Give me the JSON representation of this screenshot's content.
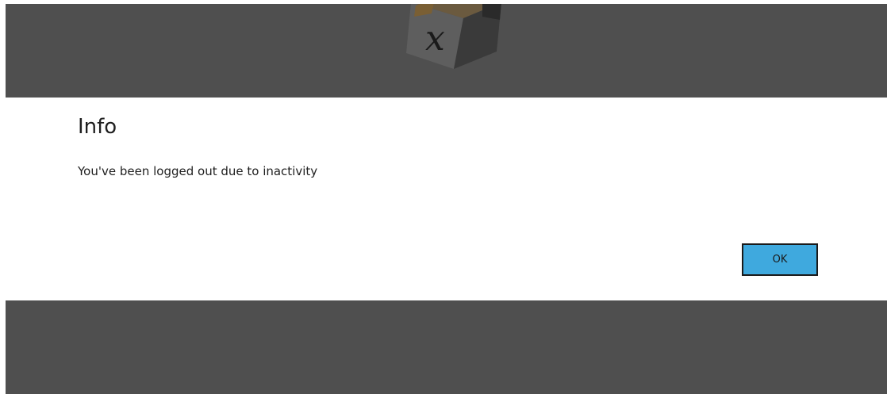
{
  "dialog": {
    "title": "Info",
    "message": "You've been logged out due to inactivity",
    "ok_label": "OK"
  },
  "logo": {
    "glyph": "x",
    "icon": "app-logo-cube-icon"
  },
  "colors": {
    "overlay": "#4f4f4f",
    "dialog_background": "#ffffff",
    "button_accent": "#3fa9de",
    "button_border": "#1a1a1a",
    "text": "#1f1f1f"
  }
}
